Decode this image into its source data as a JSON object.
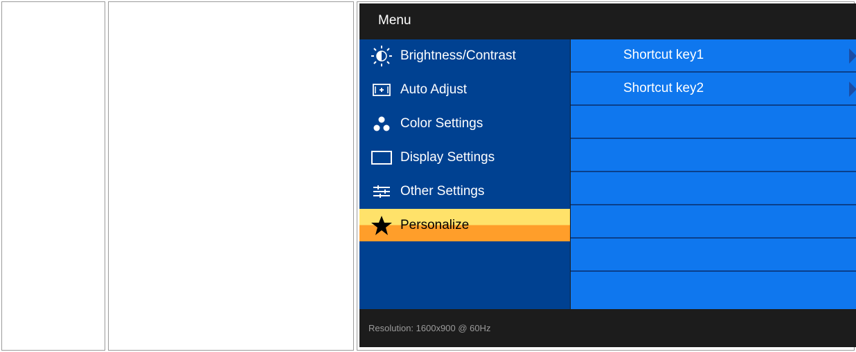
{
  "osd": {
    "title": "Menu",
    "menu_items": [
      {
        "label": "Brightness/Contrast",
        "icon": "brightness-icon"
      },
      {
        "label": "Auto Adjust",
        "icon": "auto-adjust-icon"
      },
      {
        "label": "Color Settings",
        "icon": "color-settings-icon"
      },
      {
        "label": "Display Settings",
        "icon": "display-settings-icon"
      },
      {
        "label": "Other Settings",
        "icon": "other-settings-icon"
      },
      {
        "label": "Personalize",
        "icon": "star-icon",
        "selected": true
      }
    ],
    "submenu_items": [
      {
        "label": "Shortcut key1"
      },
      {
        "label": "Shortcut key2"
      }
    ],
    "status": "Resolution:  1600x900 @ 60Hz",
    "colors": {
      "left_panel": "#004191",
      "right_panel": "#0f77ee",
      "selected_top": "#ffe26a",
      "selected_bottom": "#ff9e2a",
      "frame": "#1c1c1c"
    }
  }
}
